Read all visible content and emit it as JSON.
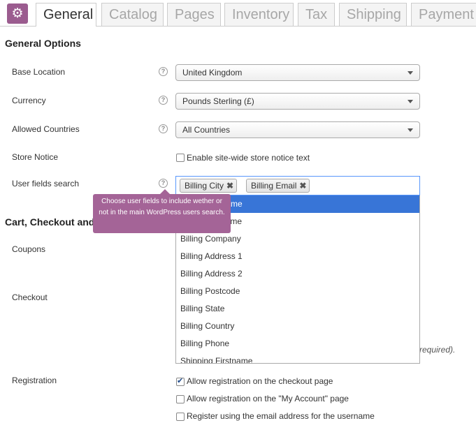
{
  "tabs": [
    {
      "label": "General",
      "active": true
    },
    {
      "label": "Catalog"
    },
    {
      "label": "Pages"
    },
    {
      "label": "Inventory"
    },
    {
      "label": "Tax"
    },
    {
      "label": "Shipping"
    },
    {
      "label": "Payment"
    }
  ],
  "general_options": {
    "heading": "General Options",
    "base_location": {
      "label": "Base Location",
      "value": "United Kingdom"
    },
    "currency": {
      "label": "Currency",
      "value": "Pounds Sterling (£)"
    },
    "allowed_countries": {
      "label": "Allowed Countries",
      "value": "All Countries"
    },
    "store_notice": {
      "label": "Store Notice",
      "checkbox_label": "Enable site-wide store notice text",
      "checked": false
    },
    "user_fields_search": {
      "label": "User fields search",
      "selected": [
        "Billing City",
        "Billing Email"
      ],
      "remove_glyph": "✖",
      "tooltip": "Choose user fields to include wether or not in the main WordPress users search.",
      "options": [
        "Billing Firstname",
        "Billing Lastname",
        "Billing Company",
        "Billing Address 1",
        "Billing Address 2",
        "Billing Postcode",
        "Billing State",
        "Billing Country",
        "Billing Phone",
        "Shipping Firstname"
      ],
      "highlighted_index": 0
    }
  },
  "cart": {
    "heading": "Cart, Checkout and",
    "coupons_label": "Coupons",
    "checkout_label": "Checkout",
    "partial_note": "required)."
  },
  "registration": {
    "label": "Registration",
    "options": [
      {
        "label": "Allow registration on the checkout page",
        "checked": true
      },
      {
        "label": "Allow registration on the \"My Account\" page",
        "checked": false
      },
      {
        "label": "Register using the email address for the username",
        "checked": false
      }
    ]
  },
  "icons": {
    "settings": "gear-icon",
    "help": "help-icon"
  },
  "colors": {
    "brand": "#9b5c8f",
    "tooltip": "#a46497",
    "highlight": "#3875d7",
    "focus_border": "#5897fb"
  }
}
